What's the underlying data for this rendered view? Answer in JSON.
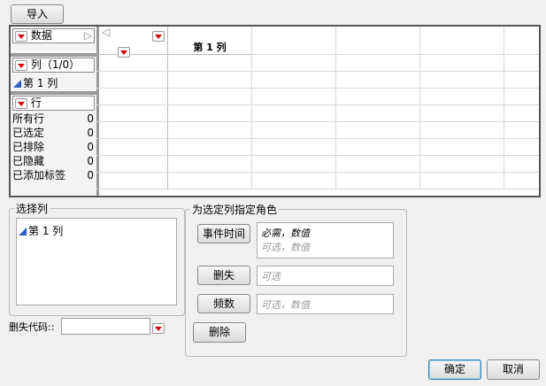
{
  "toolbar": {
    "import_label": "导入"
  },
  "table_panel": {
    "data_label": "数据",
    "columns_label": "列（1/0）",
    "column_items": [
      "第 1 列"
    ],
    "rows_label": "行",
    "row_stats": [
      {
        "label": "所有行",
        "value": "0"
      },
      {
        "label": "已选定",
        "value": "0"
      },
      {
        "label": "已排除",
        "value": "0"
      },
      {
        "label": "已隐藏",
        "value": "0"
      },
      {
        "label": "已添加标签",
        "value": "0"
      }
    ]
  },
  "grid": {
    "column_headers": [
      "第 1 列"
    ]
  },
  "select_columns": {
    "title": "选择列",
    "items": [
      "第 1 列"
    ]
  },
  "censor_code": {
    "label": "删失代码::",
    "value": ""
  },
  "roles": {
    "title": "为选定列指定角色",
    "event_time": {
      "label": "事件时间",
      "required": "必需，数值",
      "optional": "可选，数值"
    },
    "censor": {
      "label": "删失",
      "placeholder": "可选"
    },
    "freq": {
      "label": "频数",
      "placeholder": "可选，数值"
    },
    "remove_label": "删除"
  },
  "actions": {
    "ok": "确定",
    "cancel": "取消"
  }
}
